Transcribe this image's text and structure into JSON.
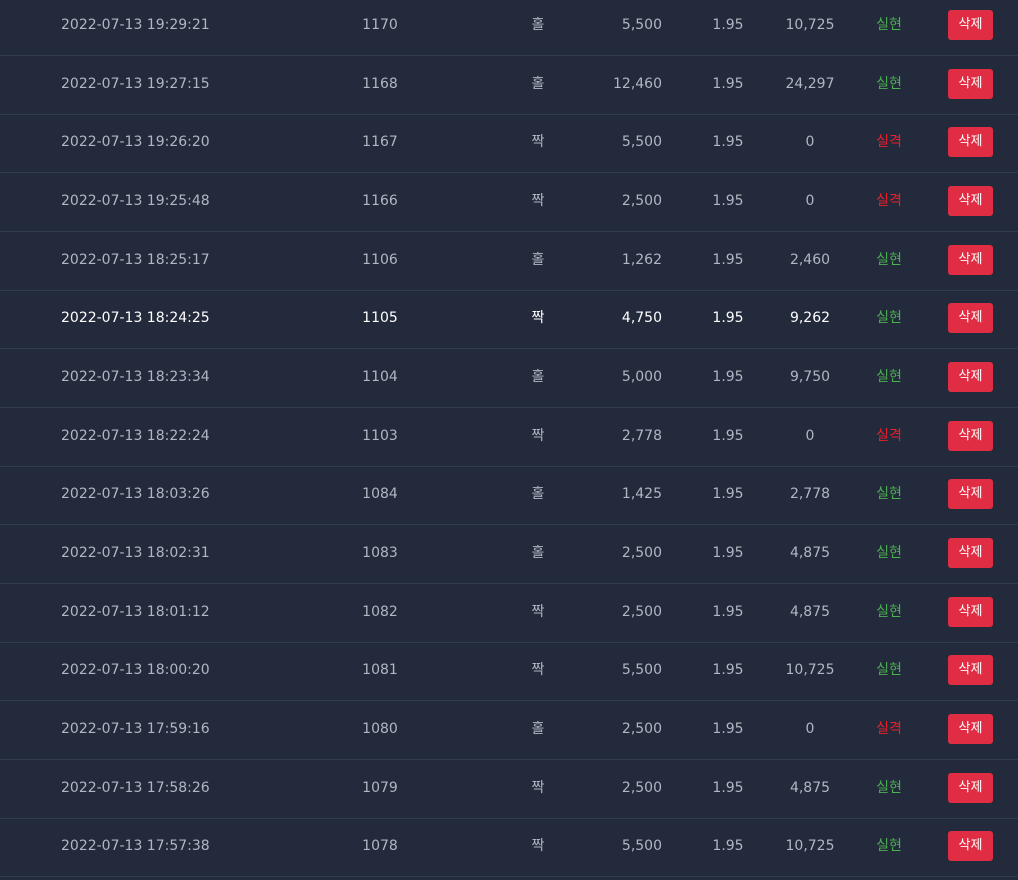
{
  "delete_label": "삭제",
  "highlight_row": 5,
  "colors": {
    "win": "#4caf50",
    "lose": "#f01e2c",
    "button": "#e12d43",
    "background": "#222a3b"
  },
  "rows": [
    {
      "time": "2022-07-13 19:29:21",
      "round": "1170",
      "pick": "홀",
      "bet": "5,500",
      "odds": "1.95",
      "payout": "10,725",
      "result": "실현",
      "status": "win"
    },
    {
      "time": "2022-07-13 19:27:15",
      "round": "1168",
      "pick": "홀",
      "bet": "12,460",
      "odds": "1.95",
      "payout": "24,297",
      "result": "실현",
      "status": "win"
    },
    {
      "time": "2022-07-13 19:26:20",
      "round": "1167",
      "pick": "짝",
      "bet": "5,500",
      "odds": "1.95",
      "payout": "0",
      "result": "실격",
      "status": "lose"
    },
    {
      "time": "2022-07-13 19:25:48",
      "round": "1166",
      "pick": "짝",
      "bet": "2,500",
      "odds": "1.95",
      "payout": "0",
      "result": "실격",
      "status": "lose"
    },
    {
      "time": "2022-07-13 18:25:17",
      "round": "1106",
      "pick": "홀",
      "bet": "1,262",
      "odds": "1.95",
      "payout": "2,460",
      "result": "실현",
      "status": "win"
    },
    {
      "time": "2022-07-13 18:24:25",
      "round": "1105",
      "pick": "짝",
      "bet": "4,750",
      "odds": "1.95",
      "payout": "9,262",
      "result": "실현",
      "status": "win"
    },
    {
      "time": "2022-07-13 18:23:34",
      "round": "1104",
      "pick": "홀",
      "bet": "5,000",
      "odds": "1.95",
      "payout": "9,750",
      "result": "실현",
      "status": "win"
    },
    {
      "time": "2022-07-13 18:22:24",
      "round": "1103",
      "pick": "짝",
      "bet": "2,778",
      "odds": "1.95",
      "payout": "0",
      "result": "실격",
      "status": "lose"
    },
    {
      "time": "2022-07-13 18:03:26",
      "round": "1084",
      "pick": "홀",
      "bet": "1,425",
      "odds": "1.95",
      "payout": "2,778",
      "result": "실현",
      "status": "win"
    },
    {
      "time": "2022-07-13 18:02:31",
      "round": "1083",
      "pick": "홀",
      "bet": "2,500",
      "odds": "1.95",
      "payout": "4,875",
      "result": "실현",
      "status": "win"
    },
    {
      "time": "2022-07-13 18:01:12",
      "round": "1082",
      "pick": "짝",
      "bet": "2,500",
      "odds": "1.95",
      "payout": "4,875",
      "result": "실현",
      "status": "win"
    },
    {
      "time": "2022-07-13 18:00:20",
      "round": "1081",
      "pick": "짝",
      "bet": "5,500",
      "odds": "1.95",
      "payout": "10,725",
      "result": "실현",
      "status": "win"
    },
    {
      "time": "2022-07-13 17:59:16",
      "round": "1080",
      "pick": "홀",
      "bet": "2,500",
      "odds": "1.95",
      "payout": "0",
      "result": "실격",
      "status": "lose"
    },
    {
      "time": "2022-07-13 17:58:26",
      "round": "1079",
      "pick": "짝",
      "bet": "2,500",
      "odds": "1.95",
      "payout": "4,875",
      "result": "실현",
      "status": "win"
    },
    {
      "time": "2022-07-13 17:57:38",
      "round": "1078",
      "pick": "짝",
      "bet": "5,500",
      "odds": "1.95",
      "payout": "10,725",
      "result": "실현",
      "status": "win"
    }
  ]
}
